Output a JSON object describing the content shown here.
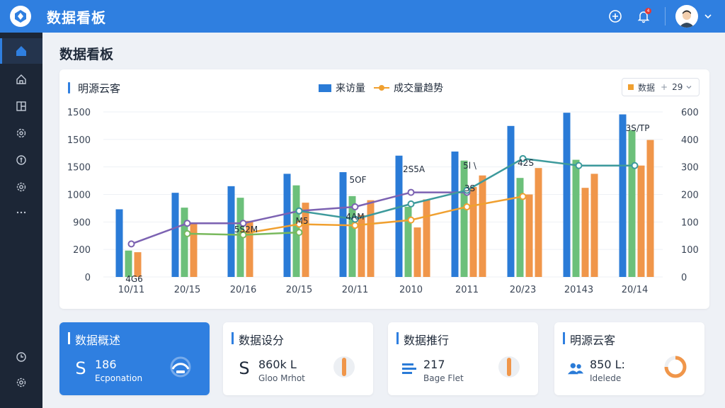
{
  "header": {
    "app_title": "数据看板",
    "notification_count": "4"
  },
  "page": {
    "title": "数据看板"
  },
  "chart_card": {
    "title": "明源云客",
    "legend": {
      "bar_label": "来访量",
      "line_label": "成交量趋势"
    },
    "filter": {
      "label": "数据",
      "value": "29"
    }
  },
  "chart_data": {
    "type": "bar",
    "title": "明源云客",
    "categories": [
      "10/11",
      "20/15",
      "20/16",
      "20/15",
      "20/11",
      "2010",
      "2011",
      "20/23",
      "20143",
      "20/14"
    ],
    "left_ticks": [
      "1500",
      "1500",
      "1500",
      "1000",
      "900",
      "200",
      "0"
    ],
    "right_ticks": [
      "600",
      "400",
      "300",
      "200",
      "100",
      "100",
      "0"
    ],
    "series": [
      {
        "name": "来访量",
        "values": [
          820,
          1020,
          1100,
          1250,
          1270,
          1470,
          1520,
          1830,
          1990,
          1970
        ],
        "color": "#2a7bd7"
      },
      {
        "values": [
          320,
          840,
          960,
          1110,
          980,
          850,
          1410,
          1200,
          1420,
          1780
        ],
        "color": "#6cc07a"
      },
      {
        "values": [
          300,
          660,
          680,
          900,
          750,
          600,
          1090,
          1000,
          1080,
          1350
        ],
        "color": "#f0964a"
      },
      {
        "values": [
          0,
          0,
          0,
          0,
          930,
          940,
          1230,
          1320,
          1250,
          1660
        ],
        "color": "#f0964a"
      }
    ],
    "lines": [
      {
        "name": "成交量趋势",
        "color": "#f0a030",
        "points": [
          null,
          null,
          105,
          128,
          125,
          138,
          170,
          195,
          null,
          null
        ]
      },
      {
        "color": "#7c62b2",
        "points": [
          80,
          130,
          130,
          160,
          170,
          205,
          205,
          null,
          null,
          null
        ]
      },
      {
        "color": "#79b95d",
        "points": [
          null,
          105,
          102,
          108,
          null,
          null,
          null,
          null,
          null,
          null
        ]
      },
      {
        "color": "#3d9a9c",
        "points": [
          null,
          null,
          null,
          160,
          140,
          177,
          210,
          287,
          270,
          270
        ]
      }
    ],
    "annotations": [
      "4G6",
      "5S2M",
      "M5",
      "5OF",
      "4AM",
      "2S5A",
      "5l \\",
      "3S",
      "42S",
      "3S/TP"
    ],
    "grid": true
  },
  "stats": [
    {
      "title": "数据概述",
      "symbol": "S",
      "value": "186",
      "sub": "Ecponation",
      "gauge_color": "#ffffff",
      "gauge_fraction": 0.5
    },
    {
      "title": "数据设分",
      "symbol": "S",
      "value": "860k  L",
      "sub": "Gloo Mrhot",
      "gauge_color": "#f0964a",
      "gauge_fraction": 0.12
    },
    {
      "title": "数据推行",
      "symbol": "≡",
      "value": "217",
      "sub": "Bage Flet",
      "gauge_color": "#f0964a",
      "gauge_fraction": 0.12
    },
    {
      "title": "明源云客",
      "symbol": "people",
      "value": "850  L:",
      "sub": "Idelede",
      "gauge_color": "#f0964a",
      "gauge_fraction": 0.75
    }
  ]
}
